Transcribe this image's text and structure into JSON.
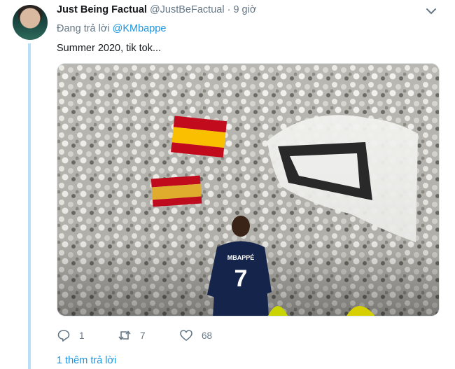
{
  "tweet": {
    "display_name": "Just Being Factual",
    "handle": "@JustBeFactual",
    "separator": "·",
    "time": "9 giờ",
    "replying_prefix": "Đang trả lời",
    "replying_to": "@KMbappe",
    "text": "Summer 2020, tik tok...",
    "media": {
      "player_name": "MBAPPÉ",
      "player_number": "7"
    }
  },
  "actions": {
    "reply_count": "1",
    "retweet_count": "7",
    "like_count": "68"
  },
  "more_replies": "1 thêm trả lời",
  "colors": {
    "link": "#1b95e0",
    "muted": "#657786",
    "thread_line": "#b9def8"
  }
}
